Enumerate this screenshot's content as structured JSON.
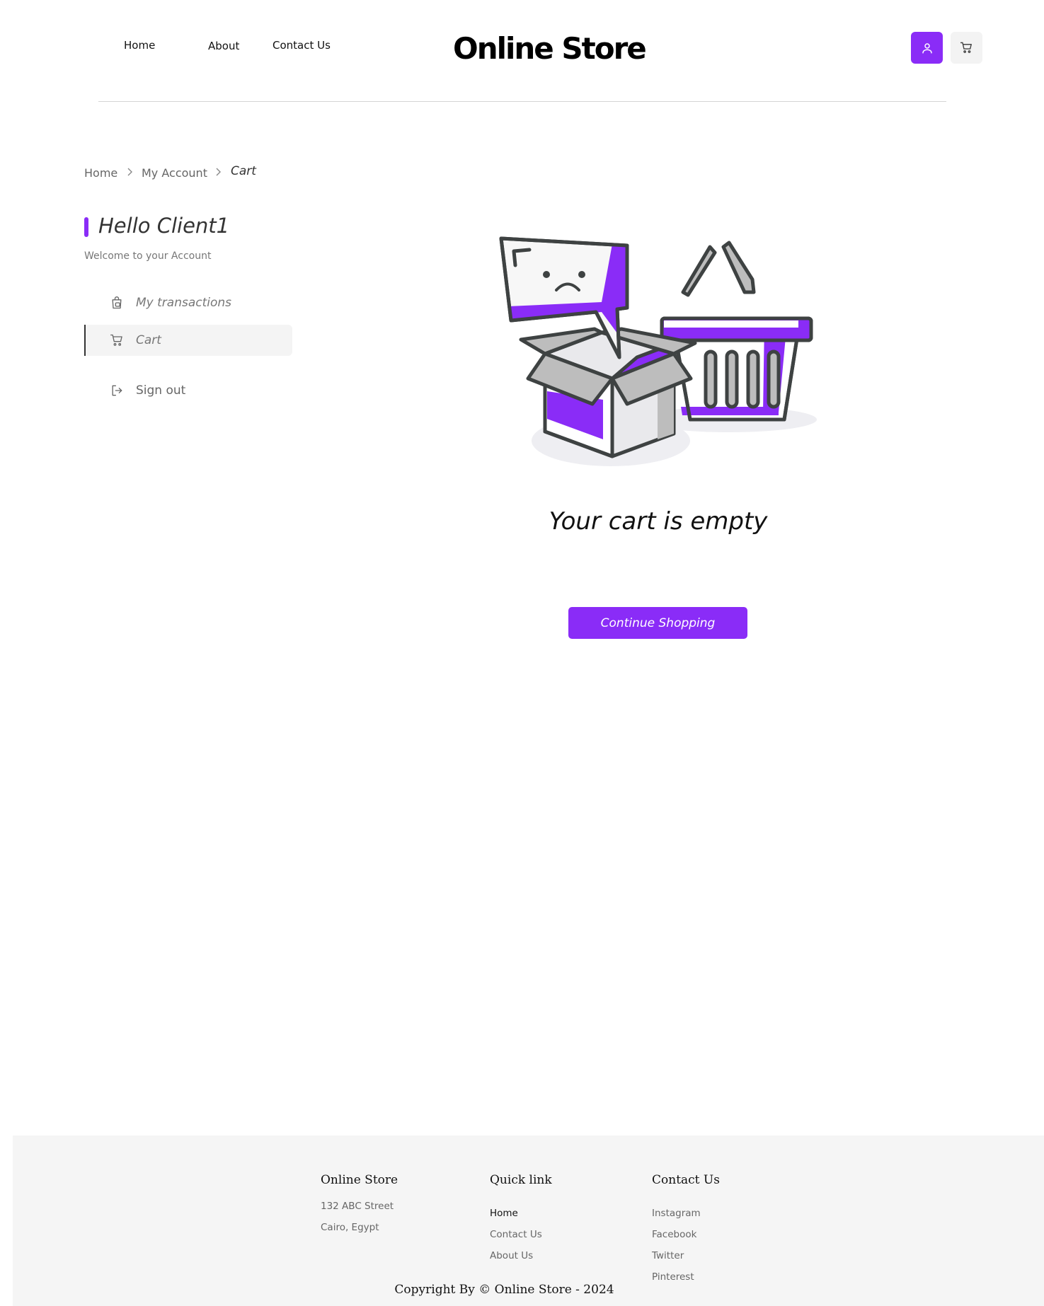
{
  "header": {
    "nav": [
      "Home",
      "About",
      "Contact Us"
    ],
    "brand": "Online Store",
    "icons": [
      "user-icon",
      "cart-icon"
    ],
    "accent_color": "#8a2cf7"
  },
  "breadcrumb": {
    "items": [
      "Home",
      "My Account",
      "Cart"
    ]
  },
  "sidebar": {
    "greeting": "Hello Client1",
    "welcome": "Welcome to your Account",
    "items": [
      {
        "label": "My transactions",
        "icon": "shopping-bag-icon"
      },
      {
        "label": "Cart",
        "icon": "cart-icon",
        "active": true
      },
      {
        "label": "Sign out",
        "icon": "sign-out-icon"
      }
    ]
  },
  "main": {
    "empty_title": "Your cart is empty",
    "cta_label": "Continue Shopping"
  },
  "footer": {
    "col1": {
      "title": "Online Store",
      "lines": [
        "132 ABC Street",
        "Cairo, Egypt"
      ]
    },
    "col2": {
      "title": "Quick link",
      "links": [
        "Home",
        "Contact Us",
        "About Us"
      ]
    },
    "col3": {
      "title": "Contact Us",
      "links": [
        "Instagram",
        "Facebook",
        "Twitter",
        "Pinterest"
      ]
    },
    "copyright": "Copyright By © Online Store - 2024"
  }
}
